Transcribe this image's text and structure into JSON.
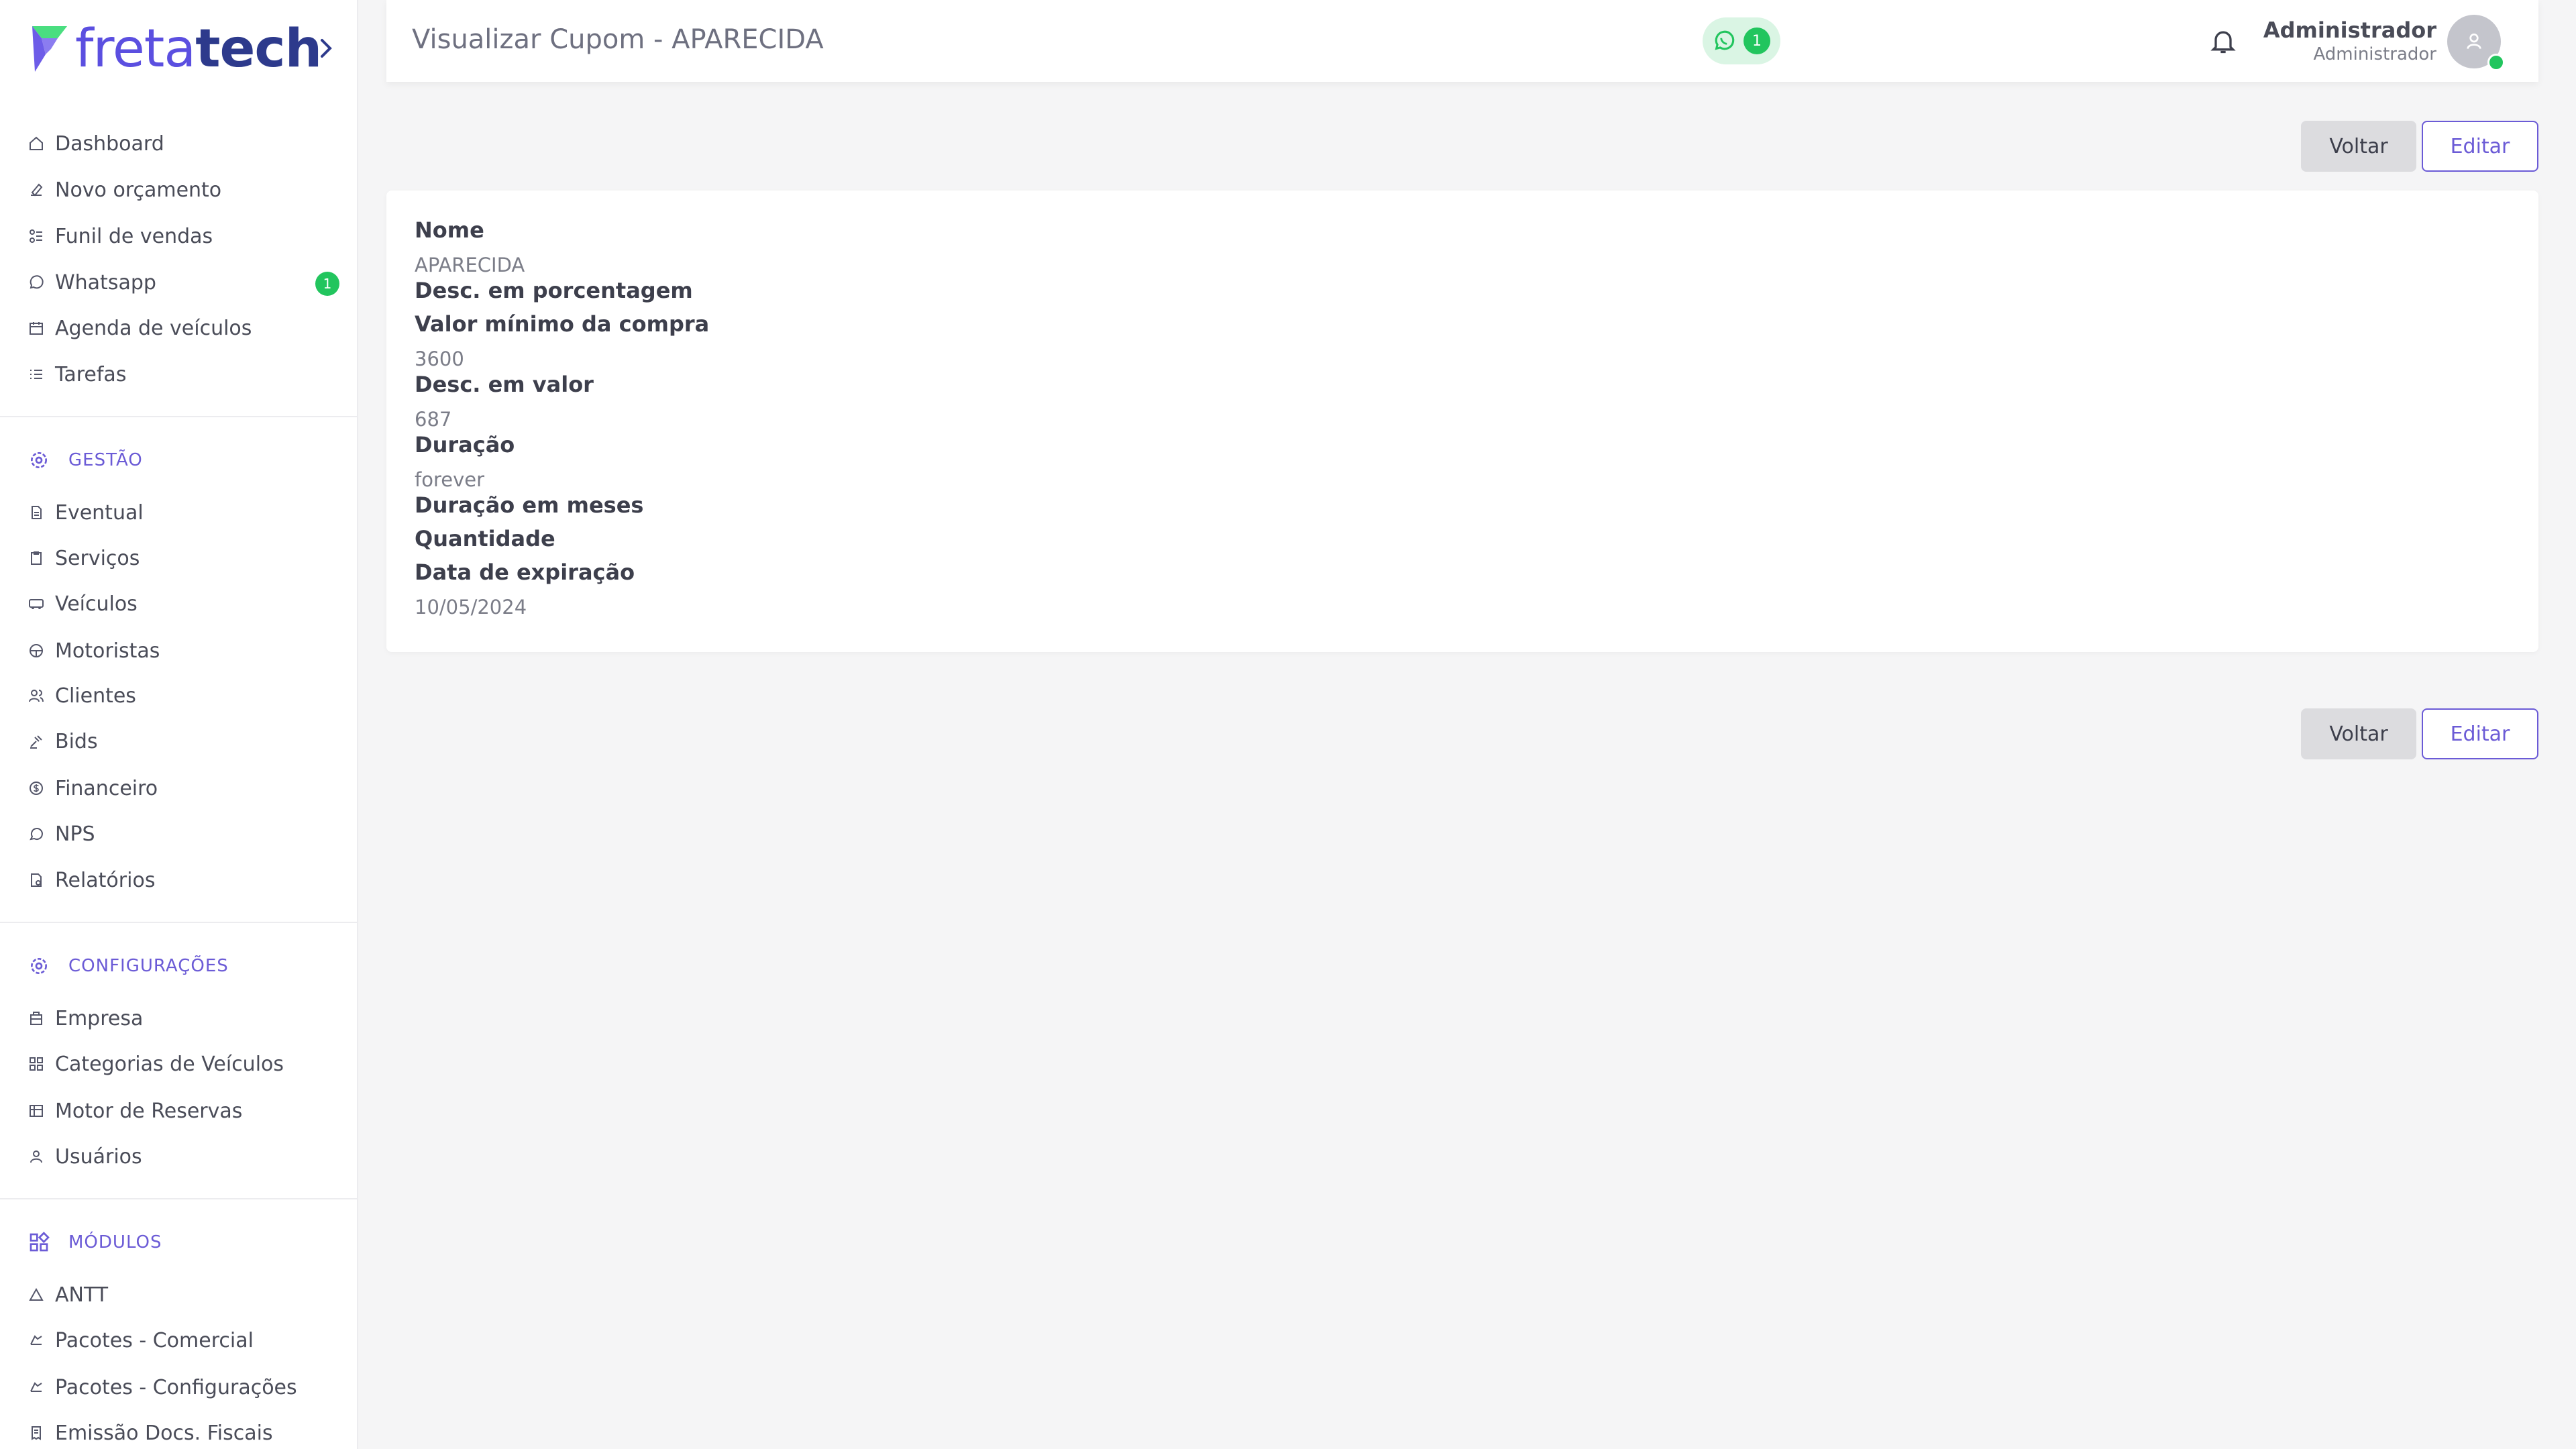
{
  "brand": {
    "part1": "freta",
    "part2": "tech"
  },
  "sidebar": {
    "main_items": [
      {
        "label": "Dashboard",
        "icon": "home-icon"
      },
      {
        "label": "Novo orçamento",
        "icon": "edit-icon"
      },
      {
        "label": "Funil de vendas",
        "icon": "funnel-icon"
      },
      {
        "label": "Whatsapp",
        "icon": "whatsapp-icon",
        "badge": "1"
      },
      {
        "label": "Agenda de veículos",
        "icon": "calendar-icon"
      },
      {
        "label": "Tarefas",
        "icon": "list-icon"
      }
    ],
    "gestao": {
      "title": "GESTÃO",
      "items": [
        {
          "label": "Eventual",
          "icon": "document-icon"
        },
        {
          "label": "Serviços",
          "icon": "clipboard-icon"
        },
        {
          "label": "Veículos",
          "icon": "bus-icon"
        },
        {
          "label": "Motoristas",
          "icon": "steering-wheel-icon"
        },
        {
          "label": "Clientes",
          "icon": "users-icon"
        },
        {
          "label": "Bids",
          "icon": "gavel-icon"
        },
        {
          "label": "Financeiro",
          "icon": "dollar-icon"
        },
        {
          "label": "NPS",
          "icon": "chat-icon"
        },
        {
          "label": "Relatórios",
          "icon": "report-icon"
        }
      ]
    },
    "configuracoes": {
      "title": "CONFIGURAÇÕES",
      "items": [
        {
          "label": "Empresa",
          "icon": "building-icon"
        },
        {
          "label": "Categorias de Veículos",
          "icon": "grid-icon"
        },
        {
          "label": "Motor de Reservas",
          "icon": "table-icon"
        },
        {
          "label": "Usuários",
          "icon": "user-icon"
        }
      ]
    },
    "modulos": {
      "title": "MÓDULOS",
      "items": [
        {
          "label": "ANTT",
          "icon": "triangle-icon"
        },
        {
          "label": "Pacotes - Comercial",
          "icon": "package-icon"
        },
        {
          "label": "Pacotes - Configurações",
          "icon": "package-settings-icon"
        },
        {
          "label": "Emissão Docs. Fiscais",
          "icon": "receipt-icon"
        }
      ]
    }
  },
  "header": {
    "title": "Visualizar Cupom - APARECIDA",
    "whatsapp_count": "1",
    "user_name": "Administrador",
    "user_role": "Administrador"
  },
  "actions": {
    "back_label": "Voltar",
    "edit_label": "Editar"
  },
  "coupon": {
    "fields": [
      {
        "label": "Nome",
        "value": "APARECIDA"
      },
      {
        "label": "Desc. em porcentagem",
        "value": ""
      },
      {
        "label": "Valor mínimo da compra",
        "value": "3600"
      },
      {
        "label": "Desc. em valor",
        "value": "687"
      },
      {
        "label": "Duração",
        "value": "forever"
      },
      {
        "label": "Duração em meses",
        "value": ""
      },
      {
        "label": "Quantidade",
        "value": ""
      },
      {
        "label": "Data de expiração",
        "value": "10/05/2024"
      }
    ]
  },
  "colors": {
    "accent": "#6b5bd6",
    "success": "#22c55e",
    "brand_dark": "#2d3a8c"
  }
}
